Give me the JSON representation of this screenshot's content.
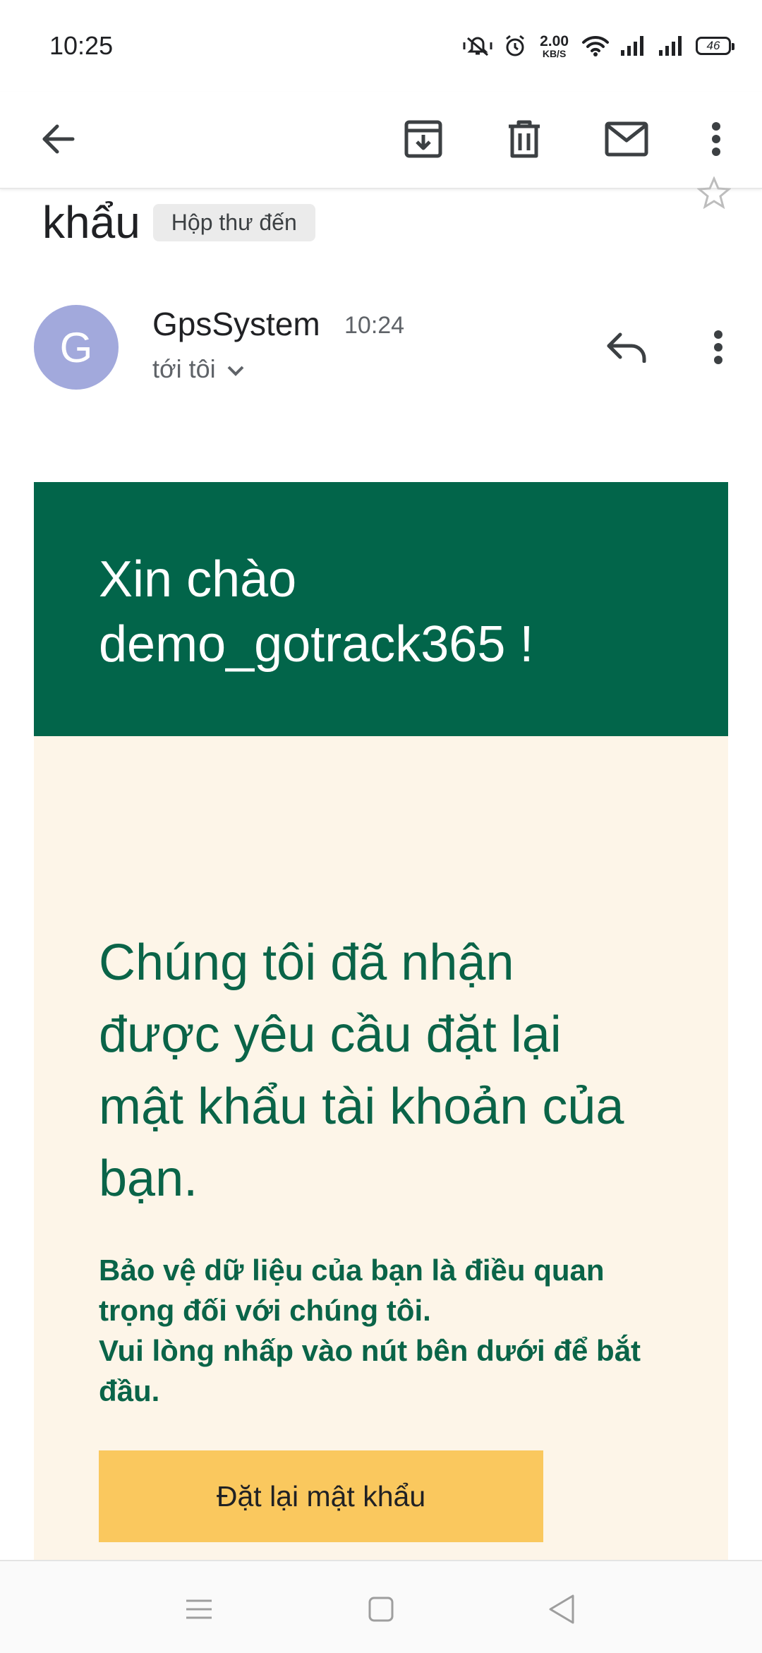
{
  "status_bar": {
    "time": "10:25",
    "net_speed_value": "2.00",
    "net_speed_unit": "KB/S",
    "battery": "46",
    "icons": [
      "vibrate-icon",
      "alarm-icon",
      "wifi-icon",
      "signal-icon",
      "signal-icon",
      "battery-icon"
    ]
  },
  "toolbar": {
    "icons": [
      "back-arrow-icon",
      "archive-icon",
      "delete-icon",
      "mark-unread-icon",
      "more-vert-icon"
    ]
  },
  "email": {
    "subject_tail": "khẩu",
    "label": "Hộp thư đến",
    "sender": {
      "avatar_letter": "G",
      "avatar_color": "#a2a9dc",
      "name": "GpsSystem",
      "time": "10:24",
      "recipient": "tới tôi"
    }
  },
  "body": {
    "greeting_line1": "Xin chào",
    "greeting_line2": "demo_gotrack365 !",
    "headline": "Chúng tôi đã nhận được yêu cầu đặt lại mật khẩu tài khoản của bạn.",
    "paragraph_line1": "Bảo vệ dữ liệu của bạn là điều quan trọng đối với chúng tôi.",
    "paragraph_line2": "Vui lòng nhấp vào nút bên dưới để bắt đầu.",
    "cta_label": "Đặt lại mật khẩu",
    "colors": {
      "header_bg": "#02654a",
      "body_bg": "#fdf5e8",
      "text_green": "#0a6448",
      "button_bg": "#fac85e"
    }
  },
  "nav_bar": {
    "icons": [
      "menu-icon",
      "home-icon",
      "back-icon"
    ]
  }
}
